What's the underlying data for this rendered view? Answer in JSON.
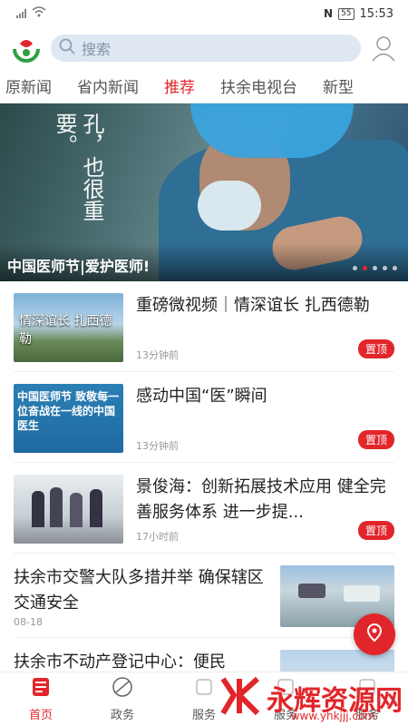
{
  "status_bar": {
    "time": "15:53",
    "battery": "55"
  },
  "search": {
    "placeholder": "搜索"
  },
  "tabs": [
    {
      "label": "原新闻"
    },
    {
      "label": "省内新闻"
    },
    {
      "label": "推荐"
    },
    {
      "label": "扶余电视台"
    },
    {
      "label": "新型"
    }
  ],
  "banner": {
    "overlay_text": "孔，也很重要。",
    "caption": "中国医师节|爱护医师!"
  },
  "news": [
    {
      "title": "重磅微视频｜情深谊长 扎西德勒",
      "time": "13分钟前",
      "badge": "置顶",
      "thumb_text": "情深谊长 扎西德勒"
    },
    {
      "title": "感动中国“医”瞬间",
      "time": "13分钟前",
      "badge": "置顶",
      "thumb_text": "中国医师节 致敬每一位奋战在一线的中国医生"
    },
    {
      "title": "景俊海：创新拓展技术应用 健全完善服务体系 进一步提...",
      "time": "17小时前",
      "badge": "置顶"
    },
    {
      "title": "扶余市交警大队多措并举 确保辖区交通安全",
      "time": "08-18"
    },
    {
      "title": "扶余市不动产登记中心：便民"
    }
  ],
  "bottom_nav": [
    {
      "label": "首页"
    },
    {
      "label": "政务"
    },
    {
      "label": "服务"
    },
    {
      "label": "服务"
    },
    {
      "label": "服务"
    }
  ],
  "watermark": {
    "brand": "永辉资源网",
    "url": "www.yhkjjj.com"
  },
  "colors": {
    "accent": "#e1262b",
    "search_bg": "#dfe7f3"
  }
}
